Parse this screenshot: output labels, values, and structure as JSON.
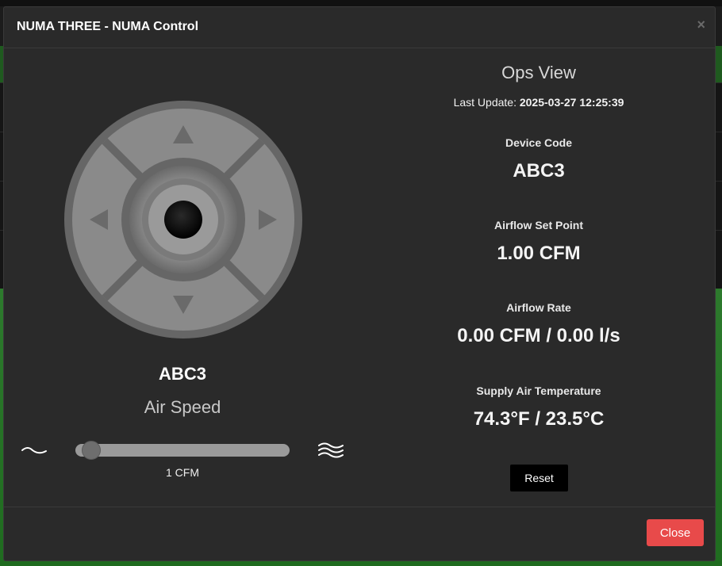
{
  "modal": {
    "title": "NUMA THREE - NUMA Control",
    "close_icon": "×",
    "footer_close_label": "Close"
  },
  "left": {
    "device_name": "ABC3",
    "air_speed_title": "Air Speed",
    "slider_value_label": "1 CFM",
    "slider_level_fraction": 0.0,
    "low_icon": "breeze-low-icon",
    "high_icon": "wind-high-icon"
  },
  "right": {
    "title": "Ops View",
    "last_update_label": "Last Update:",
    "last_update_value": "2025-03-27 12:25:39",
    "device_code_label": "Device Code",
    "device_code_value": "ABC3",
    "setpoint_label": "Airflow Set Point",
    "setpoint_value": "1.00 CFM",
    "rate_label": "Airflow Rate",
    "rate_value": "0.00 CFM / 0.00 l/s",
    "temp_label": "Supply Air Temperature",
    "temp_value": "74.3°F / 23.5°C",
    "reset_label": "Reset"
  },
  "colors": {
    "modal_bg": "#2a2a2a",
    "close_button": "#e84a4a",
    "reset_button": "#000000",
    "background_green": "#2d7a2d"
  }
}
